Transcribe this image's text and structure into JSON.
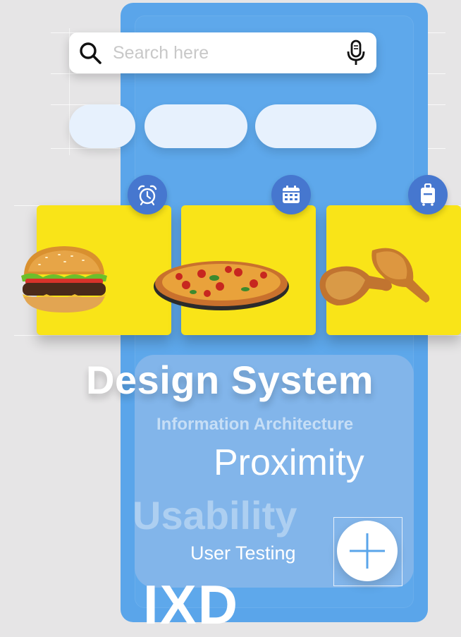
{
  "search": {
    "placeholder": "Search here",
    "search_icon": "search-icon",
    "mic_icon": "microphone-icon"
  },
  "chips": [
    {
      "label": ""
    },
    {
      "label": ""
    },
    {
      "label": ""
    }
  ],
  "cards": [
    {
      "item": "burger",
      "badge_icon": "alarm-clock-icon",
      "color": "#f9e418"
    },
    {
      "item": "pizza",
      "badge_icon": "calendar-icon",
      "color": "#f9e418"
    },
    {
      "item": "fried-chicken",
      "badge_icon": "luggage-icon",
      "color": "#f9e418"
    }
  ],
  "words": {
    "design_system": "Design System",
    "information_architecture": "Information Architecture",
    "proximity": "Proximity",
    "usability": "Usability",
    "user_testing": "User Testing",
    "ixd": "IXD"
  },
  "fab": {
    "icon": "plus-icon"
  },
  "colors": {
    "background": "#e6e5e6",
    "phone": "#5aa5ea",
    "panel": "#82b5ea",
    "chip": "#e7f1fd",
    "card": "#f9e418",
    "badge": "#4677cf",
    "fab_icon": "#5aa5ea"
  }
}
